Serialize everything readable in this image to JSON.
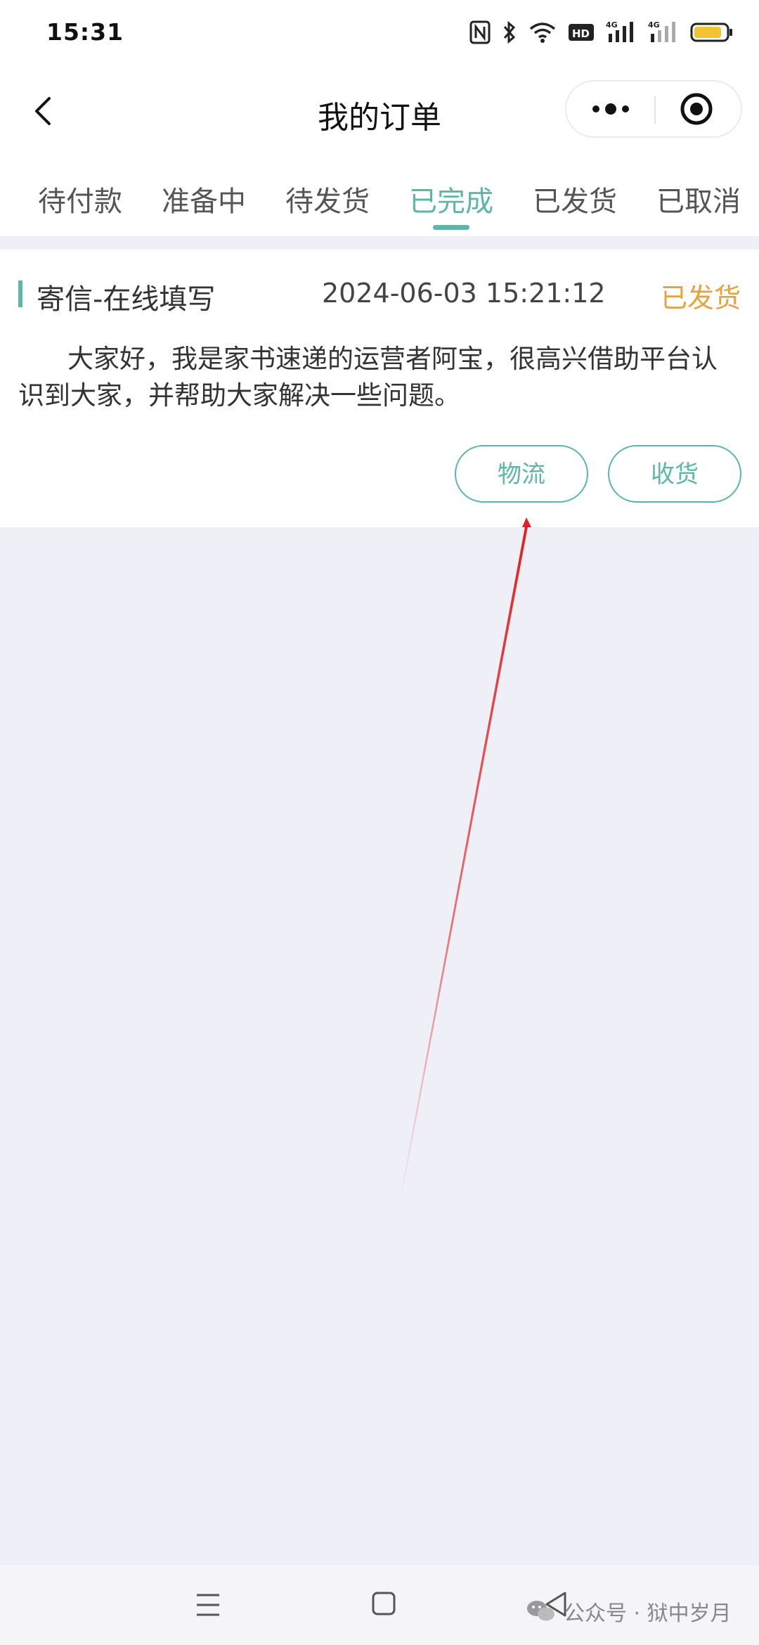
{
  "status_bar": {
    "time": "15:31",
    "icons": [
      "nfc-icon",
      "bluetooth-icon",
      "wifi-icon",
      "hd-icon",
      "signal-4g-icon",
      "signal-4g-icon",
      "battery-icon"
    ],
    "hd_label": "HD",
    "net_label": "4G"
  },
  "nav": {
    "title": "我的订单",
    "back_icon": "chevron-left-icon",
    "more_icon": "more-dots-icon",
    "target_icon": "target-icon"
  },
  "tabs": [
    {
      "label": "待付款"
    },
    {
      "label": "准备中"
    },
    {
      "label": "待发货"
    },
    {
      "label": "已完成"
    },
    {
      "label": "已发货"
    },
    {
      "label": "已取消"
    }
  ],
  "active_tab_index": 3,
  "order": {
    "type": "寄信-在线填写",
    "time": "2024-06-03 15:21:12",
    "status": "已发货",
    "content": "大家好，我是家书速递的运营者阿宝，很高兴借助平台认识到大家，并帮助大家解决一些问题。",
    "buttons": {
      "logistics": "物流",
      "receive": "收货"
    }
  },
  "watermark": {
    "text": "公众号 · 狱中岁月",
    "icon": "wechat-icon"
  },
  "colors": {
    "accent": "#5bb7a7",
    "status": "#e8a13c",
    "background": "#efeff8",
    "annotation_arrow": "#e02020"
  }
}
